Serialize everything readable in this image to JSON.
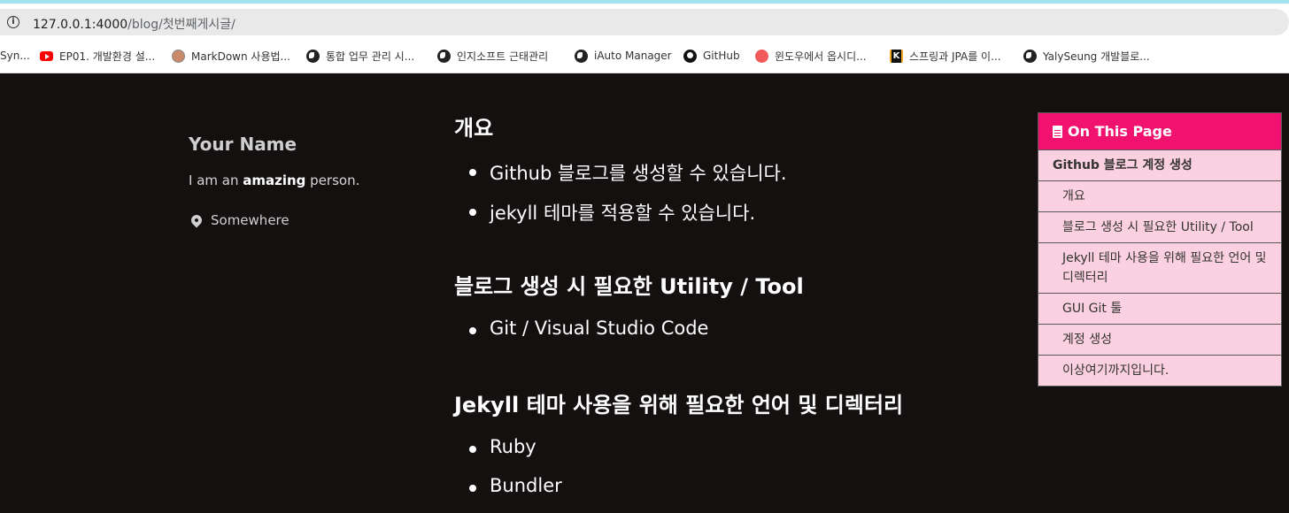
{
  "browser": {
    "url_host": "127.0.0.1:4000",
    "url_path": "/blog/첫번째게시글/",
    "bookmarks": [
      {
        "label": "Syn...",
        "icon": "none"
      },
      {
        "label": "EP01. 개발환경 설...",
        "icon": "youtube-icon"
      },
      {
        "label": "MarkDown 사용법...",
        "icon": "avatar-icon"
      },
      {
        "label": "통합 업무 관리 시...",
        "icon": "globe-icon"
      },
      {
        "label": "인지소프트 근태관리",
        "icon": "globe-icon"
      },
      {
        "label": "iAuto Manager",
        "icon": "globe-icon"
      },
      {
        "label": "GitHub",
        "icon": "github-icon"
      },
      {
        "label": "윈도우에서 옵시디...",
        "icon": "red-circle-icon"
      },
      {
        "label": "스프링과 JPA를 이...",
        "icon": "k-icon"
      },
      {
        "label": "YalySeung 개발블로...",
        "icon": "globe-icon"
      }
    ]
  },
  "author": {
    "name": "Your Name",
    "bio_prefix": "I am an ",
    "bio_bold": "amazing",
    "bio_suffix": " person.",
    "location": "Somewhere"
  },
  "content": {
    "sections": [
      {
        "heading": "개요",
        "items": [
          "Github 블로그를 생성할 수 있습니다.",
          "jekyll 테마를 적용할 수 있습니다."
        ]
      },
      {
        "heading": "블로그 생성 시 필요한 Utility / Tool",
        "items": [
          "Git / Visual Studio Code"
        ]
      },
      {
        "heading": "Jekyll 테마 사용을 위해 필요한 언어 및 디렉터리",
        "items": [
          "Ruby",
          "Bundler"
        ]
      }
    ]
  },
  "toc": {
    "title": "On This Page",
    "items": [
      "Github 블로그 계정 생성",
      "개요",
      "블로그 생성 시 필요한 Utility / Tool",
      "Jekyll 테마 사용을 위해 필요한 언어 및 디렉터리",
      "GUI Git 툴",
      "계정 생성",
      "이상여기까지입니다."
    ]
  },
  "colors": {
    "page_bg": "#141010",
    "toc_header": "#f0126e",
    "toc_bg": "#fbd0e0"
  }
}
